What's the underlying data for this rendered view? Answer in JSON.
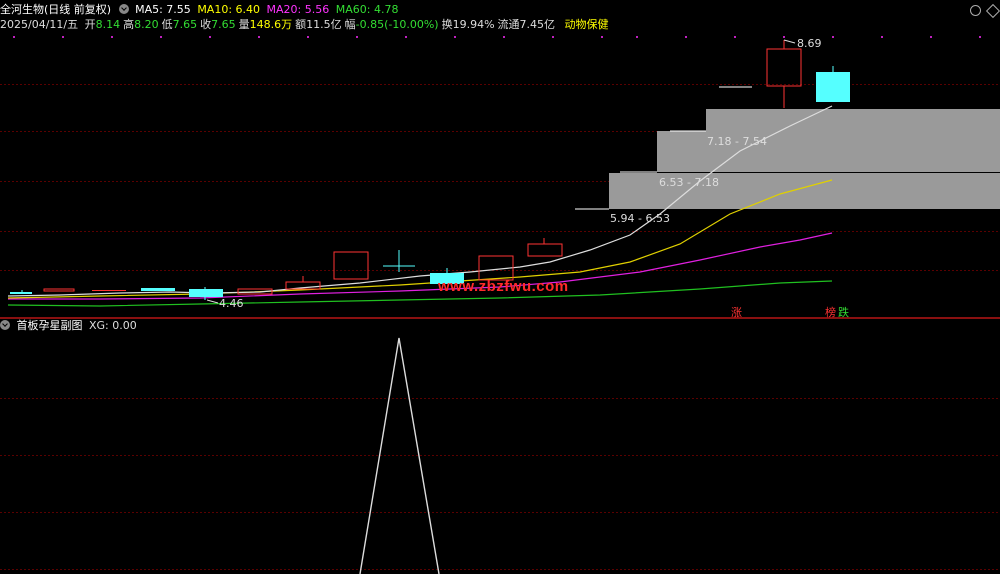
{
  "header": {
    "stock_title": "全河生物(日线 前复权)",
    "ma_items": [
      {
        "label": "MA5: 7.55",
        "color": "#ffffff"
      },
      {
        "label": "MA10: 6.40",
        "color": "#ffff00"
      },
      {
        "label": "MA20: 5.56",
        "color": "#ff33ff"
      },
      {
        "label": "MA60: 4.78",
        "color": "#33dd33"
      }
    ],
    "date": "2025/04/11/五",
    "quote": [
      {
        "k": "开",
        "v": "8.14",
        "vcolor": "#33dd33"
      },
      {
        "k": "高",
        "v": "8.20",
        "vcolor": "#33dd33"
      },
      {
        "k": "低",
        "v": "7.65",
        "vcolor": "#33dd33"
      },
      {
        "k": "收",
        "v": "7.65",
        "vcolor": "#33dd33"
      },
      {
        "k": "量",
        "v": "148.6万",
        "vcolor": "#ffff00"
      },
      {
        "k": "额",
        "v": "11.5亿",
        "vcolor": "#dddddd"
      },
      {
        "k": "幅",
        "v": "-0.85(-10.00%)",
        "vcolor": "#33dd33"
      },
      {
        "k": "换",
        "v": "19.94%",
        "vcolor": "#dddddd"
      },
      {
        "k": "流通",
        "v": "7.45亿",
        "vcolor": "#dddddd"
      }
    ],
    "sector": "动物保健"
  },
  "price_labels": {
    "high": "8.69",
    "low": "4.46",
    "zone1": "7.18 - 7.54",
    "zone2": "6.53 - 7.18",
    "zone3": "5.94 - 6.53"
  },
  "markers": {
    "zhang": "涨",
    "bang": "榜",
    "die": "跌"
  },
  "watermark": "www.zbzfwu.com",
  "indicator": {
    "title": "首板孕星副图",
    "xg": "XG: 0.00"
  },
  "colors": {
    "up": "#ff3333",
    "down": "#55ffff",
    "ma5": "#dddddd",
    "ma10": "#e0d000",
    "ma20": "#e020e0",
    "ma60": "#20c020",
    "zone": "#9a9a9a"
  }
}
